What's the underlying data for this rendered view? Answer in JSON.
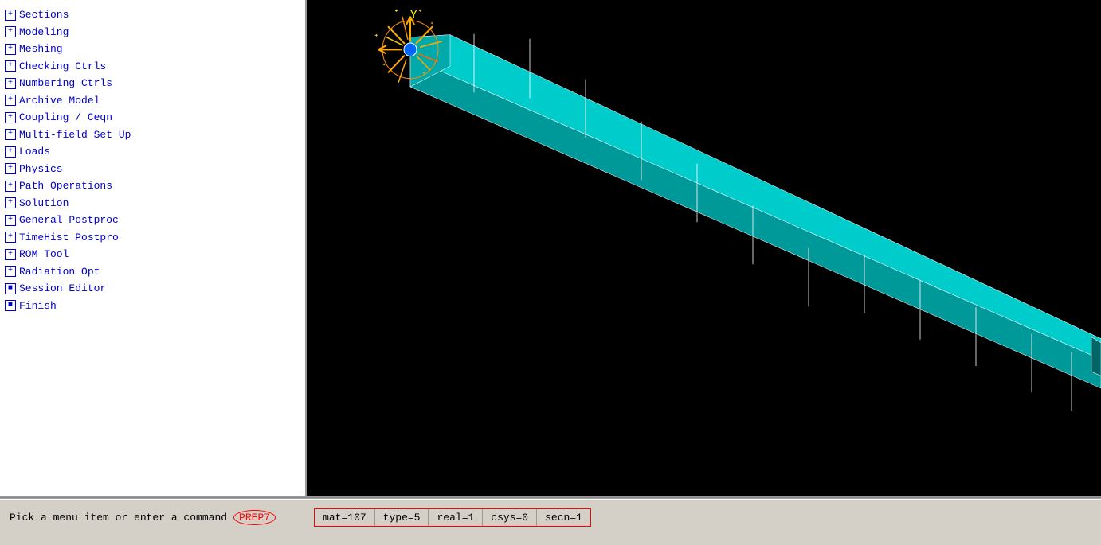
{
  "sidebar": {
    "items": [
      {
        "id": "sections",
        "label": "Sections",
        "icon": "plus",
        "indent": 0
      },
      {
        "id": "modeling",
        "label": "Modeling",
        "icon": "plus",
        "indent": 0
      },
      {
        "id": "meshing",
        "label": "Meshing",
        "icon": "plus",
        "indent": 0
      },
      {
        "id": "checking-ctrls",
        "label": "Checking Ctrls",
        "icon": "plus",
        "indent": 0
      },
      {
        "id": "numbering-ctrls",
        "label": "Numbering Ctrls",
        "icon": "plus",
        "indent": 0
      },
      {
        "id": "archive-model",
        "label": "Archive Model",
        "icon": "plus",
        "indent": 0
      },
      {
        "id": "coupling-ceqn",
        "label": "Coupling / Ceqn",
        "icon": "plus",
        "indent": 0
      },
      {
        "id": "multi-field-setup",
        "label": "Multi-field Set Up",
        "icon": "plus",
        "indent": 0
      },
      {
        "id": "loads",
        "label": "Loads",
        "icon": "plus",
        "indent": 0
      },
      {
        "id": "physics",
        "label": "Physics",
        "icon": "plus",
        "indent": 0
      },
      {
        "id": "path-operations",
        "label": "Path Operations",
        "icon": "plus",
        "indent": 0
      },
      {
        "id": "solution",
        "label": "Solution",
        "icon": "plus",
        "indent": 0
      },
      {
        "id": "general-postproc",
        "label": "General Postproc",
        "icon": "plus",
        "indent": 0
      },
      {
        "id": "timehist-postpro",
        "label": "TimeHist Postpro",
        "icon": "plus",
        "indent": 0
      },
      {
        "id": "rom-tool",
        "label": "ROM Tool",
        "icon": "plus",
        "indent": 0
      },
      {
        "id": "radiation-opt",
        "label": "Radiation Opt",
        "icon": "plus",
        "indent": 0
      },
      {
        "id": "session-editor",
        "label": "Session Editor",
        "icon": "square",
        "indent": 0
      },
      {
        "id": "finish",
        "label": "Finish",
        "icon": "square",
        "indent": 0
      }
    ]
  },
  "viewport": {
    "y_label": "Y"
  },
  "status_bar": {
    "command_prompt": "Pick a menu item or enter a command",
    "mode_badge": "PREP7",
    "params": [
      {
        "id": "mat",
        "label": "mat=107"
      },
      {
        "id": "type",
        "label": "type=5"
      },
      {
        "id": "real",
        "label": "real=1"
      },
      {
        "id": "csys",
        "label": "csys=0"
      },
      {
        "id": "secn",
        "label": "secn=1"
      }
    ]
  },
  "icons": {
    "plus": "+",
    "square": "■"
  }
}
